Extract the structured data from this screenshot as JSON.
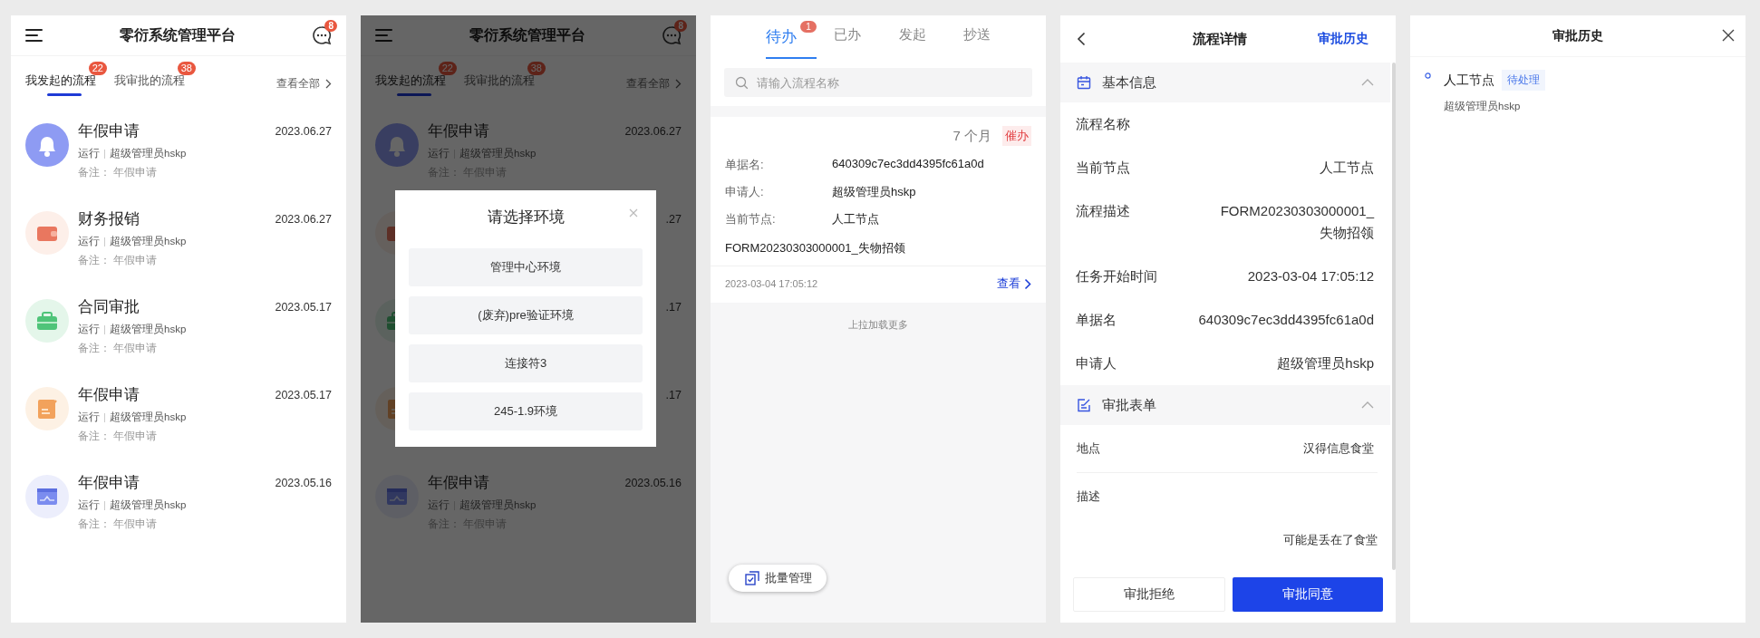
{
  "home": {
    "title": "零衍系统管理平台",
    "message_badge": "8",
    "tabs": [
      {
        "label": "我发起的流程",
        "badge": "22",
        "selected": true
      },
      {
        "label": "我审批的流程",
        "badge": "38",
        "selected": false
      }
    ],
    "view_all": "查看全部",
    "items": [
      {
        "kind": "full",
        "title": "年假申请",
        "date": "2023.06.27",
        "status": "运行",
        "user": "超级管理员hskp",
        "note_label": "备注：",
        "note": "年假申请"
      },
      {
        "kind": "full",
        "title": "财务报销",
        "date": "2023.06.27",
        "status": "运行",
        "user": "超级管理员hskp",
        "note_label": "备注：",
        "note": "年假申请"
      },
      {
        "kind": "full",
        "title": "合同审批",
        "date": "2023.05.17",
        "status": "运行",
        "user": "超级管理员hskp",
        "note_label": "备注：",
        "note": "年假申请"
      },
      {
        "kind": "full",
        "title": "年假申请",
        "date": "2023.05.17",
        "status": "运行",
        "user": "超级管理员hskp",
        "note_label": "备注：",
        "note": "年假申请"
      },
      {
        "kind": "full",
        "title": "年假申请",
        "date": "2023.05.16",
        "status": "运行",
        "user": "超级管理员hskp",
        "note_label": "备注：",
        "note": "年假申请"
      }
    ]
  },
  "dimmed_home": {
    "title": "零衍系统管理平台",
    "message_badge": "8",
    "tabs": [
      {
        "label": "我发起的流程",
        "badge": "22",
        "selected": true
      },
      {
        "label": "我审批的流程",
        "badge": "38",
        "selected": false
      }
    ],
    "view_all": "查看全部",
    "items": [
      {
        "kind": "full",
        "title": "年假申请",
        "date": "2023.06.27",
        "status": "运行",
        "user": "超级管理员hskp",
        "note_label": "备注：",
        "note": "年假申请"
      },
      {
        "kind": "covered",
        "date": ".27"
      },
      {
        "kind": "covered",
        "date": ".17"
      },
      {
        "kind": "covered",
        "date": ".17"
      },
      {
        "kind": "full",
        "title": "年假申请",
        "date": "2023.05.16",
        "status": "运行",
        "user": "超级管理员hskp",
        "note_label": "备注：",
        "note": "年假申请"
      }
    ],
    "dialog": {
      "title": "请选择环境",
      "options": [
        "管理中心环境",
        "(废弃)pre验证环境",
        "连接符3",
        "245-1.9环境"
      ]
    }
  },
  "todo": {
    "tabs": [
      {
        "label": "待办",
        "badge": "1",
        "selected": true
      },
      {
        "label": "已办",
        "selected": false
      },
      {
        "label": "发起",
        "selected": false
      },
      {
        "label": "抄送",
        "selected": false
      }
    ],
    "search": {
      "placeholder": "请输入流程名称"
    },
    "card": {
      "age": "7 个月",
      "urge": "催办",
      "fields": [
        {
          "label": "单据名:",
          "value": "640309c7ec3dd4395fc61a0d"
        },
        {
          "label": "申请人:",
          "value": "超级管理员hskp"
        },
        {
          "label": "当前节点:",
          "value": "人工节点"
        }
      ],
      "description": "FORM20230303000001_失物招领",
      "time": "2023-03-04 17:05:12",
      "view": "查看"
    },
    "load_more": "上拉加载更多",
    "batch_button": "批量管理"
  },
  "detail": {
    "title": "流程详情",
    "history_link": "审批历史",
    "sections": [
      {
        "title": "基本信息",
        "expanded": true,
        "rows": [
          {
            "kind": "inline",
            "label": "流程名称"
          },
          {
            "kind": "inline",
            "label": "当前节点",
            "value": "人工节点"
          },
          {
            "kind": "inline",
            "label": "流程描述",
            "value": "FORM20230303000001_\n失物招领"
          },
          {
            "kind": "inline",
            "label": "任务开始时间",
            "value": "2023-03-04 17:05:12"
          },
          {
            "kind": "inline",
            "label": "单据名",
            "value": "640309c7ec3dd4395fc61a0d"
          },
          {
            "kind": "inline",
            "label": "申请人",
            "value": "超级管理员hskp"
          }
        ]
      },
      {
        "title": "审批表单",
        "expanded": true,
        "rows": [
          {
            "kind": "field",
            "label": "地点",
            "value": "汉得信息食堂"
          },
          {
            "kind": "stacked",
            "label": "描述",
            "value": "可能是丢在了食堂"
          }
        ]
      }
    ],
    "buttons": [
      {
        "kind": "reject",
        "label": "审批拒绝"
      },
      {
        "kind": "approve",
        "label": "审批同意"
      }
    ]
  },
  "history": {
    "title": "审批历史",
    "entries": [
      {
        "node": "人工节点",
        "status": "待处理",
        "user": "超级管理员hskp"
      }
    ]
  }
}
